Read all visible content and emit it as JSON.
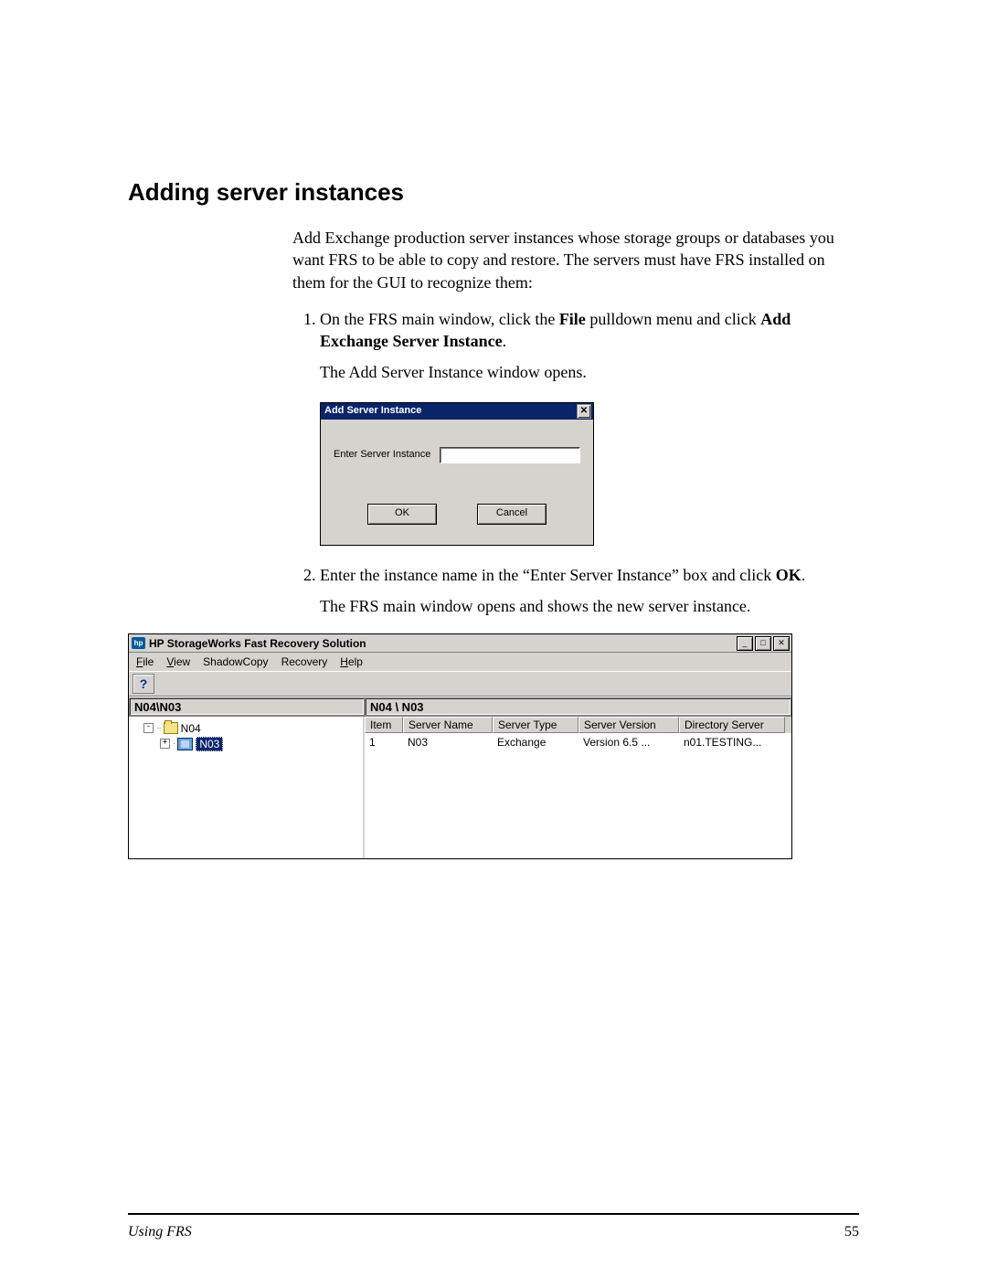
{
  "heading": "Adding server instances",
  "intro": "Add Exchange production server instances whose storage groups or databases you want FRS to be able to copy and restore. The servers must have FRS installed on them for the GUI to recognize them:",
  "step1_prefix": "On the FRS main window, click the ",
  "step1_bold1": "File",
  "step1_mid": " pulldown menu and click ",
  "step1_bold2": "Add Exchange Server Instance",
  "step1_suffix": ".",
  "step1_after": "The Add Server Instance window opens.",
  "dialog": {
    "title": "Add Server Instance",
    "label": "Enter Server Instance",
    "ok": "OK",
    "cancel": "Cancel"
  },
  "step2_prefix": "Enter the instance name in the “Enter Server Instance” box and click ",
  "step2_bold": "OK",
  "step2_suffix": ".",
  "step2_after": "The FRS main window opens and shows the new server instance.",
  "frs": {
    "title": "HP StorageWorks Fast Recovery Solution",
    "menu": {
      "file": "File",
      "view": "View",
      "shadow": "ShadowCopy",
      "recovery": "Recovery",
      "help": "Help"
    },
    "help_glyph": "?",
    "path_left": "N04\\N03",
    "path_right": "N04 \\ N03",
    "tree": {
      "root": "N04",
      "child": "N03"
    },
    "columns": {
      "item": "Item",
      "name": "Server Name",
      "type": "Server Type",
      "version": "Server Version",
      "dir": "Directory Server"
    },
    "row": {
      "item": "1",
      "name": "N03",
      "type": "Exchange",
      "version": "Version 6.5 ...",
      "dir": "n01.TESTING..."
    }
  },
  "footer": {
    "section": "Using FRS",
    "page": "55"
  }
}
